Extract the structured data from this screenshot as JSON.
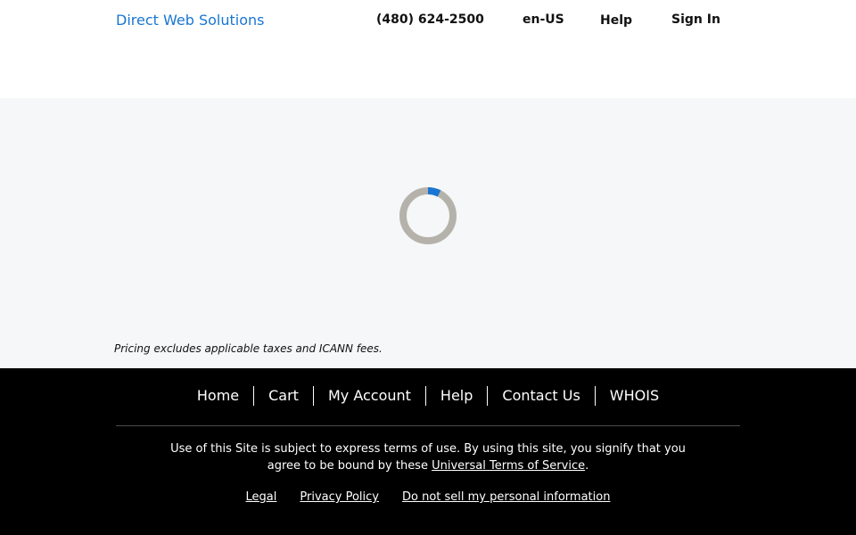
{
  "header": {
    "brand": "Direct Web Solutions",
    "phone": "(480) 624-2500",
    "locale": "en-US",
    "help": "Help",
    "sign_in": "Sign In"
  },
  "main": {
    "spinner_icon": "loading-spinner-icon",
    "pricing_note": "Pricing excludes applicable taxes and ICANN fees."
  },
  "footer": {
    "nav": [
      "Home",
      "Cart",
      "My Account",
      "Help",
      "Contact Us",
      "WHOIS"
    ],
    "terms_before": "Use of this Site is subject to express terms of use. By using this site, you signify that you agree to be bound by these ",
    "terms_link": "Universal Terms of Service",
    "terms_after": ".",
    "legal_links": [
      "Legal",
      "Privacy Policy",
      "Do not sell my personal information"
    ]
  },
  "colors": {
    "brand": "#1976d2",
    "main_bg": "#f5f7f8",
    "footer_bg": "#000000",
    "spinner_track": "#b5b2ab",
    "spinner_accent": "#1976d2"
  }
}
